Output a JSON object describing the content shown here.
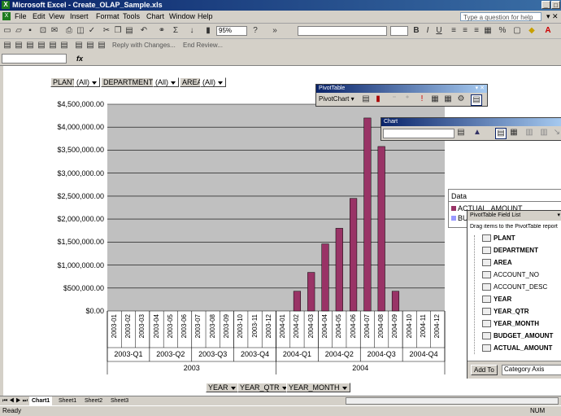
{
  "window": {
    "title": "Microsoft Excel - Create_OLAP_Sample.xls",
    "app_icon": "excel-icon"
  },
  "menu": {
    "items": [
      "File",
      "Edit",
      "View",
      "Insert",
      "Format",
      "Tools",
      "Chart",
      "Window",
      "Help"
    ],
    "help_placeholder": "Type a question for help"
  },
  "toolbar": {
    "zoom": "95%",
    "reply_with_changes": "Reply with Changes...",
    "end_review": "End Review..."
  },
  "formula": {
    "fx": "fx"
  },
  "pivot_fields_top": [
    {
      "name": "PLANT",
      "value": "(All)"
    },
    {
      "name": "DEPARTMENT",
      "value": "(All)"
    },
    {
      "name": "AREA",
      "value": "(All)"
    }
  ],
  "pivot_fields_bottom": [
    "YEAR",
    "YEAR_QTR",
    "YEAR_MONTH"
  ],
  "pivot_toolbar": {
    "title": "PivotTable",
    "pivot_chart_label": "PivotChart"
  },
  "chart_toolbar": {
    "title": "Chart"
  },
  "legend": {
    "title": "Data",
    "items": [
      "ACTUAL_AMOUNT",
      "BUDGET_AMOUNT"
    ]
  },
  "field_list": {
    "title": "PivotTable Field List",
    "instruction": "Drag items to the PivotTable report",
    "fields": [
      "PLANT",
      "DEPARTMENT",
      "AREA",
      "ACCOUNT_NO",
      "ACCOUNT_DESC",
      "YEAR",
      "YEAR_QTR",
      "YEAR_MONTH",
      "BUDGET_AMOUNT",
      "ACTUAL_AMOUNT"
    ],
    "bold_fields": [
      "PLANT",
      "DEPARTMENT",
      "AREA",
      "YEAR",
      "YEAR_QTR",
      "YEAR_MONTH",
      "BUDGET_AMOUNT",
      "ACTUAL_AMOUNT"
    ],
    "add_to_label": "Add To",
    "add_to_value": "Category Axis"
  },
  "sheets": {
    "tabs": [
      "Chart1",
      "Sheet1",
      "Sheet2",
      "Sheet3"
    ],
    "active": "Chart1"
  },
  "status": {
    "left": "Ready",
    "right": "NUM"
  },
  "colors": {
    "bar": "#993366",
    "plot_bg": "#c0c0c0"
  },
  "chart_data": {
    "type": "bar",
    "categories": [
      "2003-01",
      "2003-02",
      "2003-03",
      "2003-04",
      "2003-05",
      "2003-06",
      "2003-07",
      "2003-08",
      "2003-09",
      "2003-10",
      "2003-11",
      "2003-12",
      "2004-01",
      "2004-02",
      "2004-03",
      "2004-04",
      "2004-05",
      "2004-06",
      "2004-07",
      "2004-08",
      "2004-09",
      "2004-10",
      "2004-11",
      "2004-12"
    ],
    "quarters": [
      "2003-Q1",
      "2003-Q2",
      "2003-Q3",
      "2003-Q4",
      "2004-Q1",
      "2004-Q2",
      "2004-Q3",
      "2004-Q4"
    ],
    "years": [
      "2003",
      "2004"
    ],
    "series": [
      {
        "name": "ACTUAL_AMOUNT",
        "values": [
          0,
          0,
          0,
          0,
          0,
          0,
          0,
          0,
          0,
          0,
          0,
          0,
          0,
          430000,
          840000,
          1460000,
          1800000,
          2450000,
          4200000,
          3580000,
          430000,
          0,
          0,
          0
        ]
      }
    ],
    "ylim": [
      0,
      4500000
    ],
    "ytick_values": [
      0,
      500000,
      1000000,
      1500000,
      2000000,
      2500000,
      3000000,
      3500000,
      4000000,
      4500000
    ],
    "ytick_labels": [
      "$0.00",
      "$500,000.00",
      "$1,000,000.00",
      "$1,500,000.00",
      "$2,000,000.00",
      "$2,500,000.00",
      "$3,000,000.00",
      "$3,500,000.00",
      "$4,000,000.00",
      "$4,500,000.00"
    ],
    "grid": true,
    "legend": "right"
  }
}
